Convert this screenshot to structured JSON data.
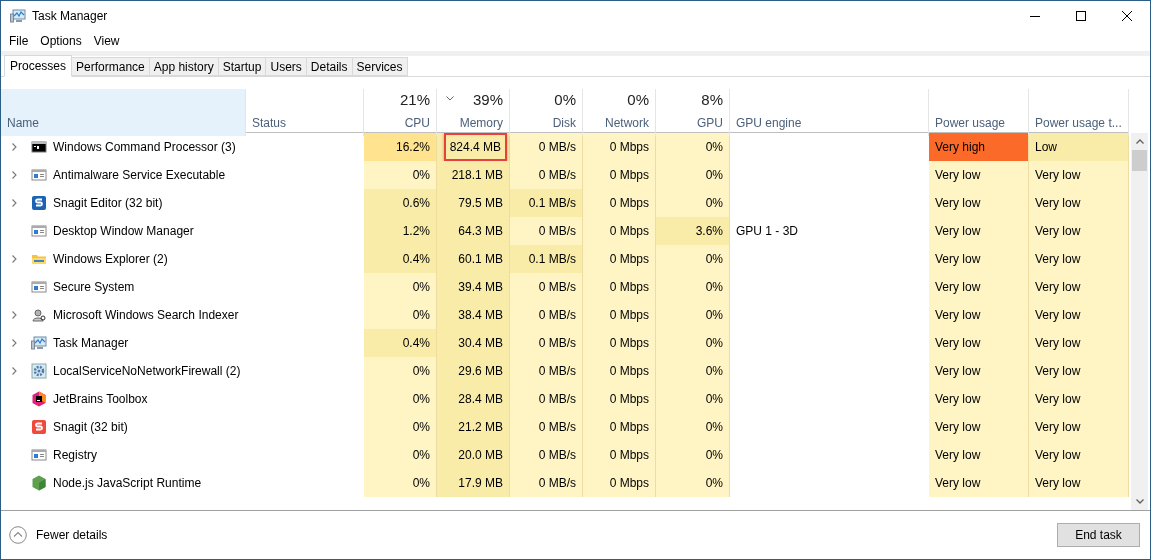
{
  "window": {
    "title": "Task Manager"
  },
  "menu": [
    "File",
    "Options",
    "View"
  ],
  "tabs": [
    {
      "label": "Processes",
      "selected": true
    },
    {
      "label": "Performance",
      "selected": false
    },
    {
      "label": "App history",
      "selected": false
    },
    {
      "label": "Startup",
      "selected": false
    },
    {
      "label": "Users",
      "selected": false
    },
    {
      "label": "Details",
      "selected": false
    },
    {
      "label": "Services",
      "selected": false
    }
  ],
  "columns": [
    {
      "label": "Name",
      "selected": true
    },
    {
      "label": "Status",
      "selected": false
    },
    {
      "label": "CPU",
      "total": "21%",
      "sorted": false,
      "selected": false
    },
    {
      "label": "Memory",
      "total": "39%",
      "sorted": true,
      "selected": false
    },
    {
      "label": "Disk",
      "total": "0%",
      "sorted": false,
      "selected": false
    },
    {
      "label": "Network",
      "total": "0%",
      "sorted": false,
      "selected": false
    },
    {
      "label": "GPU",
      "total": "8%",
      "sorted": false,
      "selected": false
    },
    {
      "label": "GPU engine",
      "selected": false
    },
    {
      "label": "Power usage",
      "selected": false
    },
    {
      "label": "Power usage t...",
      "selected": false
    }
  ],
  "rows": [
    {
      "name": "Windows Command Processor (3)",
      "kind": "console",
      "expandable": true,
      "cells": [
        {
          "text": "16.2%",
          "color": "#ffe38f"
        },
        {
          "text": "824.4 MB",
          "color": "#f9eca8",
          "highlighted": true
        },
        {
          "text": "0 MB/s",
          "color": "#fff4c4"
        },
        {
          "text": "0 Mbps",
          "color": "#fff4c4"
        },
        {
          "text": "0%",
          "color": "#fff4c4"
        },
        {},
        {
          "text": "Very high",
          "color": "#fc6a2a"
        },
        {
          "text": "Low",
          "color": "#f9eca8"
        }
      ]
    },
    {
      "name": "Antimalware Service Executable",
      "kind": "window",
      "expandable": true,
      "cells": [
        {
          "text": "0%",
          "color": "#fff4c4"
        },
        {
          "text": "218.1 MB",
          "color": "#f9eca8"
        },
        {
          "text": "0 MB/s",
          "color": "#fff4c4"
        },
        {
          "text": "0 Mbps",
          "color": "#fff4c4"
        },
        {
          "text": "0%",
          "color": "#fff4c4"
        },
        {},
        {
          "text": "Very low",
          "color": "#fff4c4"
        },
        {
          "text": "Very low",
          "color": "#fff4c4"
        }
      ]
    },
    {
      "name": "Snagit Editor (32 bit)",
      "kind": "snagit-editor",
      "expandable": true,
      "cells": [
        {
          "text": "0.6%",
          "color": "#f9eca8"
        },
        {
          "text": "79.5 MB",
          "color": "#f9eca8"
        },
        {
          "text": "0.1 MB/s",
          "color": "#f9eca8"
        },
        {
          "text": "0 Mbps",
          "color": "#fff4c4"
        },
        {
          "text": "0%",
          "color": "#fff4c4"
        },
        {},
        {
          "text": "Very low",
          "color": "#fff4c4"
        },
        {
          "text": "Very low",
          "color": "#fff4c4"
        }
      ]
    },
    {
      "name": "Desktop Window Manager",
      "kind": "window",
      "expandable": false,
      "cells": [
        {
          "text": "1.2%",
          "color": "#f9eca8"
        },
        {
          "text": "64.3 MB",
          "color": "#f9eca8"
        },
        {
          "text": "0 MB/s",
          "color": "#fff4c4"
        },
        {
          "text": "0 Mbps",
          "color": "#fff4c4"
        },
        {
          "text": "3.6%",
          "color": "#f9eca8"
        },
        {
          "text": "GPU 1 - 3D"
        },
        {
          "text": "Very low",
          "color": "#fff4c4"
        },
        {
          "text": "Very low",
          "color": "#fff4c4"
        }
      ]
    },
    {
      "name": "Windows Explorer (2)",
      "kind": "folder",
      "expandable": true,
      "cells": [
        {
          "text": "0.4%",
          "color": "#f9eca8"
        },
        {
          "text": "60.1 MB",
          "color": "#f9eca8"
        },
        {
          "text": "0.1 MB/s",
          "color": "#f9eca8"
        },
        {
          "text": "0 Mbps",
          "color": "#fff4c4"
        },
        {
          "text": "0%",
          "color": "#fff4c4"
        },
        {},
        {
          "text": "Very low",
          "color": "#fff4c4"
        },
        {
          "text": "Very low",
          "color": "#fff4c4"
        }
      ]
    },
    {
      "name": "Secure System",
      "kind": "window",
      "expandable": false,
      "cells": [
        {
          "text": "0%",
          "color": "#fff4c4"
        },
        {
          "text": "39.4 MB",
          "color": "#f9eca8"
        },
        {
          "text": "0 MB/s",
          "color": "#fff4c4"
        },
        {
          "text": "0 Mbps",
          "color": "#fff4c4"
        },
        {
          "text": "0%",
          "color": "#fff4c4"
        },
        {},
        {
          "text": "Very low",
          "color": "#fff4c4"
        },
        {
          "text": "Very low",
          "color": "#fff4c4"
        }
      ]
    },
    {
      "name": "Microsoft Windows Search Indexer",
      "kind": "search-user",
      "expandable": true,
      "cells": [
        {
          "text": "0%",
          "color": "#fff4c4"
        },
        {
          "text": "38.4 MB",
          "color": "#f9eca8"
        },
        {
          "text": "0 MB/s",
          "color": "#fff4c4"
        },
        {
          "text": "0 Mbps",
          "color": "#fff4c4"
        },
        {
          "text": "0%",
          "color": "#fff4c4"
        },
        {},
        {
          "text": "Very low",
          "color": "#fff4c4"
        },
        {
          "text": "Very low",
          "color": "#fff4c4"
        }
      ]
    },
    {
      "name": "Task Manager",
      "kind": "monitor",
      "expandable": true,
      "cells": [
        {
          "text": "0.4%",
          "color": "#f9eca8"
        },
        {
          "text": "30.4 MB",
          "color": "#f9eca8"
        },
        {
          "text": "0 MB/s",
          "color": "#fff4c4"
        },
        {
          "text": "0 Mbps",
          "color": "#fff4c4"
        },
        {
          "text": "0%",
          "color": "#fff4c4"
        },
        {},
        {
          "text": "Very low",
          "color": "#fff4c4"
        },
        {
          "text": "Very low",
          "color": "#fff4c4"
        }
      ]
    },
    {
      "name": "LocalServiceNoNetworkFirewall (2)",
      "kind": "gear",
      "expandable": true,
      "cells": [
        {
          "text": "0%",
          "color": "#fff4c4"
        },
        {
          "text": "29.6 MB",
          "color": "#f9eca8"
        },
        {
          "text": "0 MB/s",
          "color": "#fff4c4"
        },
        {
          "text": "0 Mbps",
          "color": "#fff4c4"
        },
        {
          "text": "0%",
          "color": "#fff4c4"
        },
        {},
        {
          "text": "Very low",
          "color": "#fff4c4"
        },
        {
          "text": "Very low",
          "color": "#fff4c4"
        }
      ]
    },
    {
      "name": "JetBrains Toolbox",
      "kind": "hexagon",
      "expandable": false,
      "cells": [
        {
          "text": "0%",
          "color": "#fff4c4"
        },
        {
          "text": "28.4 MB",
          "color": "#f9eca8"
        },
        {
          "text": "0 MB/s",
          "color": "#fff4c4"
        },
        {
          "text": "0 Mbps",
          "color": "#fff4c4"
        },
        {
          "text": "0%",
          "color": "#fff4c4"
        },
        {},
        {
          "text": "Very low",
          "color": "#fff4c4"
        },
        {
          "text": "Very low",
          "color": "#fff4c4"
        }
      ]
    },
    {
      "name": "Snagit (32 bit)",
      "kind": "snagit",
      "expandable": false,
      "cells": [
        {
          "text": "0%",
          "color": "#fff4c4"
        },
        {
          "text": "21.2 MB",
          "color": "#f9eca8"
        },
        {
          "text": "0 MB/s",
          "color": "#fff4c4"
        },
        {
          "text": "0 Mbps",
          "color": "#fff4c4"
        },
        {
          "text": "0%",
          "color": "#fff4c4"
        },
        {},
        {
          "text": "Very low",
          "color": "#fff4c4"
        },
        {
          "text": "Very low",
          "color": "#fff4c4"
        }
      ]
    },
    {
      "name": "Registry",
      "kind": "window",
      "expandable": false,
      "cells": [
        {
          "text": "0%",
          "color": "#fff4c4"
        },
        {
          "text": "20.0 MB",
          "color": "#f9eca8"
        },
        {
          "text": "0 MB/s",
          "color": "#fff4c4"
        },
        {
          "text": "0 Mbps",
          "color": "#fff4c4"
        },
        {
          "text": "0%",
          "color": "#fff4c4"
        },
        {},
        {
          "text": "Very low",
          "color": "#fff4c4"
        },
        {
          "text": "Very low",
          "color": "#fff4c4"
        }
      ]
    },
    {
      "name": "Node.js JavaScript Runtime",
      "kind": "node",
      "expandable": false,
      "cells": [
        {
          "text": "0%",
          "color": "#fff4c4"
        },
        {
          "text": "17.9 MB",
          "color": "#f9eca8"
        },
        {
          "text": "0 MB/s",
          "color": "#fff4c4"
        },
        {
          "text": "0 Mbps",
          "color": "#fff4c4"
        },
        {
          "text": "0%",
          "color": "#fff4c4"
        },
        {},
        {
          "text": "Very low",
          "color": "#fff4c4"
        },
        {
          "text": "Very low",
          "color": "#fff4c4"
        }
      ]
    }
  ],
  "footer": {
    "details_link": "Fewer details",
    "end_button": "End task"
  }
}
